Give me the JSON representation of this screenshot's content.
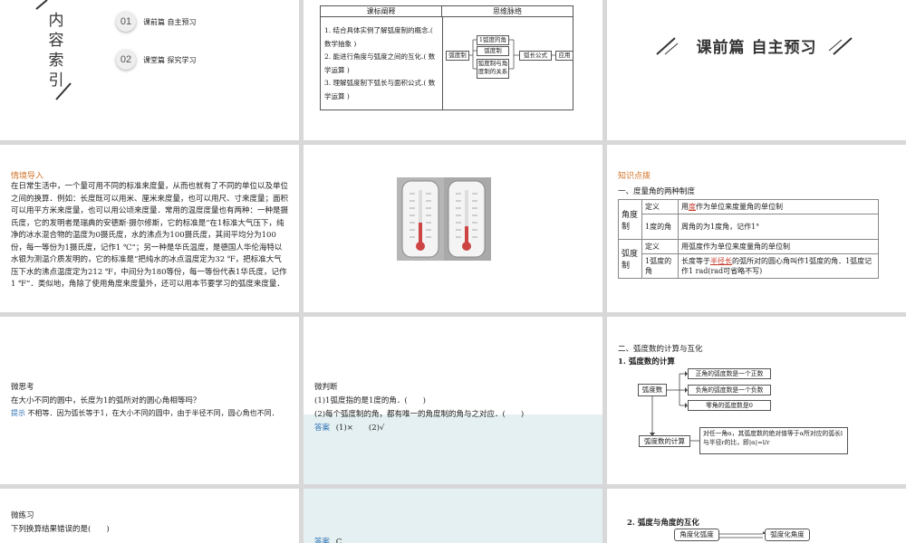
{
  "slide1": {
    "vertical_title": [
      "内",
      "容",
      "索",
      "引"
    ],
    "items": [
      {
        "num": "01",
        "label": "课前篇 自主预习"
      },
      {
        "num": "02",
        "label": "课堂篇 探究学习"
      }
    ]
  },
  "slide2": {
    "col1_header": "课标阐释",
    "col2_header": "思维脉络",
    "points": [
      "1. 结合具体实例了解弧度制的概念.( 数学抽象 )",
      "2. 能进行角度与弧度之间的互化.( 数学运算 )",
      "3. 理解弧度制下弧长与面积公式.( 数学运算 )"
    ],
    "diagram": {
      "root": "弧度制",
      "branches": [
        "1弧度的角",
        "弧度制",
        "弧度制与角度制的关系"
      ],
      "next": "弧长公式",
      "last": "应用"
    }
  },
  "slide3": {
    "title": "课前篇 自主预习"
  },
  "slide4": {
    "heading": "情境导入",
    "body": "在日常生活中，一个量可用不同的标准来度量，从而也就有了不同的单位以及单位之间的换算．例如：长度既可以用米、厘米来度量，也可以用尺、寸来度量；面积可以用平方米来度量，也可以用公顷来度量．常用的温度度量也有两种：一种是摄氏度，它的发明者是瑞典的安德斯·摄尔修斯，它的标准是“在1标准大气压下，纯净的冰水混合物的温度为0摄氏度，水的沸点为100摄氏度，其间平均分为100份，每一等份为1摄氏度，记作1 ℃”；另一种是华氏温度，是德国人华伦海特以水银为测温介质发明的，它的标准是“把纯水的冰点温度定为32 ℉，把标准大气压下水的沸点温度定为212 ℉，中间分为180等份，每一等份代表1华氏度，记作1 ℉”．类似地，角除了使用角度来度量外，还可以用本节要学习的弧度来度量．"
  },
  "slide6": {
    "heading": "知识点拨",
    "subheading": "一、度量角的两种制度",
    "rows": [
      {
        "group": "角度制",
        "label": "定义",
        "text_pre": "用",
        "text_red": "度",
        "text_post": "作为单位来度量角的单位制"
      },
      {
        "group": "",
        "label": "1度的角",
        "text_pre": "周角的",
        "text_red": "",
        "text_post": "为1度角，记作1°"
      },
      {
        "group": "弧度制",
        "label": "定义",
        "text_pre": "用弧度作为单位来度量角的单位制",
        "text_red": "",
        "text_post": ""
      },
      {
        "group": "",
        "label": "1弧度的角",
        "text_pre": "长度等于",
        "text_red": "半径长",
        "text_post": "的弧所对的圆心角叫作1弧度的角．1弧度记作1 rad(rad可省略不写)"
      }
    ]
  },
  "slide7": {
    "heading": "微思考",
    "question": "在大小不同的圆中，长度为1的弧所对的圆心角相等吗？",
    "hint_label": "提示",
    "hint": "不相等．因为弧长等于1，在大小不同的圆中，由于半径不同，圆心角也不同．"
  },
  "slide8": {
    "heading": "微判断",
    "q1": "(1)1弧度指的是1度的角．(　　)",
    "q2": "(2)每个弧度制的角，都有唯一的角度制的角与之对应．(　　)",
    "answer_label": "答案",
    "answer": "(1)×　　(2)√"
  },
  "slide9": {
    "heading": "二、弧度数的计算与互化",
    "sub": "1. 弧度数的计算",
    "node1": "弧度数",
    "rules": [
      "正角的弧度数是一个正数",
      "负角的弧度数是一个负数",
      "零角的弧度数是0"
    ],
    "node2": "弧度数的计算",
    "formula": "对任一角α，其弧度数的绝对值等于α所对应的弧长l与半径r的比，即|α|=l/r"
  },
  "slide10": {
    "heading": "微练习",
    "question": "下列换算结果错误的是(　　)"
  },
  "slide11": {
    "answer_label": "答案",
    "answer": "C"
  },
  "slide12": {
    "sub": "2. 弧度与角度的互化",
    "left": "角度化弧度",
    "right": "弧度化角度"
  }
}
